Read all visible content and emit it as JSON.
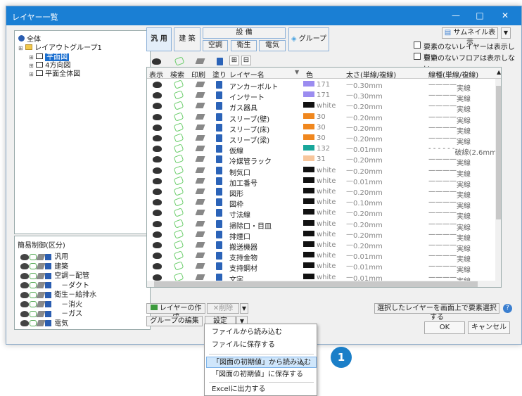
{
  "window": {
    "title": "レイヤー一覧",
    "minimize": "—",
    "maximize": "□",
    "close": "✕"
  },
  "tree": {
    "root": "全体",
    "group": "レイアウトグループ1",
    "items": [
      "平面図",
      "4方向図",
      "平面全体図"
    ],
    "expander": "⊞"
  },
  "simple": {
    "header": "簡易制御(区分)",
    "items": [
      "汎用",
      "建築",
      "空調－配管",
      "　－ダクト",
      "衛生－給排水",
      "　－消火",
      "　－ガス",
      "電気"
    ]
  },
  "tabs": {
    "general": "汎 用",
    "arch": "建 築",
    "equipment": "設 備",
    "hvac": "空調",
    "plumbing": "衛生",
    "electric": "電気",
    "group": "グループ"
  },
  "view_toggles": {
    "grid1": "⊞",
    "grid2": "⊟"
  },
  "thumbnail": {
    "label": "サムネイル表示",
    "arrow": "▼"
  },
  "options": [
    "要素のないレイヤーは表示しない",
    "要素のないフロアは表示しない"
  ],
  "grid": {
    "headers": [
      "表示",
      "検索",
      "印刷",
      "塗り",
      "レイヤー名",
      "色",
      "太さ(単線/複線)",
      "線種(単線/複線)"
    ],
    "rows": [
      {
        "name": "アンカーボルト",
        "color_label": "171",
        "color_hex": "#9b8cf0",
        "width": "0.30mm",
        "linetype": "実線"
      },
      {
        "name": "インサート",
        "color_label": "171",
        "color_hex": "#9b8cf0",
        "width": "0.30mm",
        "linetype": "実線"
      },
      {
        "name": "ガス器具",
        "color_label": "white",
        "color_hex": "#111111",
        "width": "0.20mm",
        "linetype": "実線"
      },
      {
        "name": "スリーブ(壁)",
        "color_label": "30",
        "color_hex": "#f0871e",
        "width": "0.20mm",
        "linetype": "実線"
      },
      {
        "name": "スリーブ(床)",
        "color_label": "30",
        "color_hex": "#f0871e",
        "width": "0.20mm",
        "linetype": "実線"
      },
      {
        "name": "スリーブ(梁)",
        "color_label": "30",
        "color_hex": "#f0871e",
        "width": "0.20mm",
        "linetype": "実線"
      },
      {
        "name": "仮線",
        "color_label": "132",
        "color_hex": "#18a69a",
        "width": "0.01mm",
        "linetype": "破線(2.6mm)"
      },
      {
        "name": "冷媒管ラック",
        "color_label": "31",
        "color_hex": "#f7c69c",
        "width": "0.20mm",
        "linetype": "実線"
      },
      {
        "name": "制気口",
        "color_label": "white",
        "color_hex": "#111111",
        "width": "0.20mm",
        "linetype": "実線"
      },
      {
        "name": "加工番号",
        "color_label": "white",
        "color_hex": "#111111",
        "width": "0.01mm",
        "linetype": "実線"
      },
      {
        "name": "図形",
        "color_label": "white",
        "color_hex": "#111111",
        "width": "0.20mm",
        "linetype": "実線"
      },
      {
        "name": "図枠",
        "color_label": "white",
        "color_hex": "#111111",
        "width": "0.10mm",
        "linetype": "実線"
      },
      {
        "name": "寸法線",
        "color_label": "white",
        "color_hex": "#111111",
        "width": "0.20mm",
        "linetype": "実線"
      },
      {
        "name": "掃除口・目皿",
        "color_label": "white",
        "color_hex": "#111111",
        "width": "0.20mm",
        "linetype": "実線"
      },
      {
        "name": "排煙口",
        "color_label": "white",
        "color_hex": "#111111",
        "width": "0.20mm",
        "linetype": "実線"
      },
      {
        "name": "搬送機器",
        "color_label": "white",
        "color_hex": "#111111",
        "width": "0.20mm",
        "linetype": "実線"
      },
      {
        "name": "支持金物",
        "color_label": "white",
        "color_hex": "#111111",
        "width": "0.01mm",
        "linetype": "実線"
      },
      {
        "name": "支持鋼材",
        "color_label": "white",
        "color_hex": "#111111",
        "width": "0.01mm",
        "linetype": "実線"
      },
      {
        "name": "文字",
        "color_label": "white",
        "color_hex": "#111111",
        "width": "0.01mm",
        "linetype": "実線"
      }
    ]
  },
  "actions": {
    "create": "レイヤーの作成",
    "delete": "削除",
    "group_edit": "グループの編集",
    "settings": "設定",
    "dropdown": "▼",
    "select_on_screen": "選択したレイヤーを画面上で要素選択する",
    "help": "?",
    "ok": "OK",
    "cancel": "キャンセル"
  },
  "menu": {
    "items": [
      "ファイルから読み込む",
      "ファイルに保存する",
      "「図面の初期値」から読み込む",
      "「図面の初期値」に保存する",
      "Excelに出力する"
    ]
  },
  "badge": "1",
  "colors": {
    "titlebar": "#1a7fd4",
    "badge": "#1b7fc8",
    "menu_highlight": "#cfe6fb"
  }
}
